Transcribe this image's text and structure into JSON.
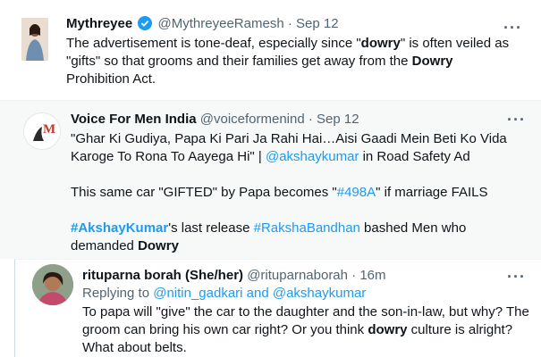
{
  "tweet1": {
    "name": "Mythreyee",
    "handle": "@MythreyeeRamesh",
    "sep": "·",
    "date": "Sep 12",
    "more": "···",
    "line1_a": "The advertisement is tone-deaf, especially since \"",
    "line1_b": "dowry",
    "line1_c": "\" is often veiled as",
    "line2_a": "\"gifts\" so that grooms and their families get away from the ",
    "line2_b": "Dowry",
    "line3": "Prohibition Act."
  },
  "tweet2": {
    "name": "Voice For Men India",
    "handle": "@voiceformenind",
    "sep": "·",
    "date": "Sep 12",
    "more": "···",
    "avatar_letter": "M",
    "line1": "\"Ghar Ki Gudiya, Papa Ki Pari Ja Rahi Hai…Aisi Gaadi Mein Beti Ko Vida",
    "line2_a": "Karoge To Rona To Aayega Hi\" |  ",
    "line2_mention": "@akshaykumar",
    "line2_b": " in Road Safety Ad",
    "line3_a": "This same car \"GIFTED\" by Papa becomes \"",
    "line3_tag": "#498A",
    "line3_b": "\" if marriage FAILS",
    "line4_tag1": "#AkshayKumar",
    "line4_a": "'s last release ",
    "line4_tag2": "#RakshaBandhan",
    "line4_b": " bashed Men who",
    "line5_a": "demanded ",
    "line5_b": "Dowry"
  },
  "tweet3": {
    "name": "rituparna borah (She/her)",
    "handle": "@rituparnaborah",
    "sep": "·",
    "date": "16m",
    "more": "···",
    "reply_prefix": "Replying to ",
    "reply_targets": "@nitin_gadkari and @akshaykumar",
    "line1": "To papa will \"give\" the car to the daughter and the son-in-law, but why? The",
    "line2_a": "groom can bring his own car right? Or you think ",
    "line2_b": "dowry",
    "line2_c": " culture is alright?",
    "line3": "What about belts."
  },
  "colors": {
    "link": "#1d9bf0",
    "text": "#0f1419",
    "muted": "#536471",
    "quoted_bg": "#f7f9f9"
  }
}
